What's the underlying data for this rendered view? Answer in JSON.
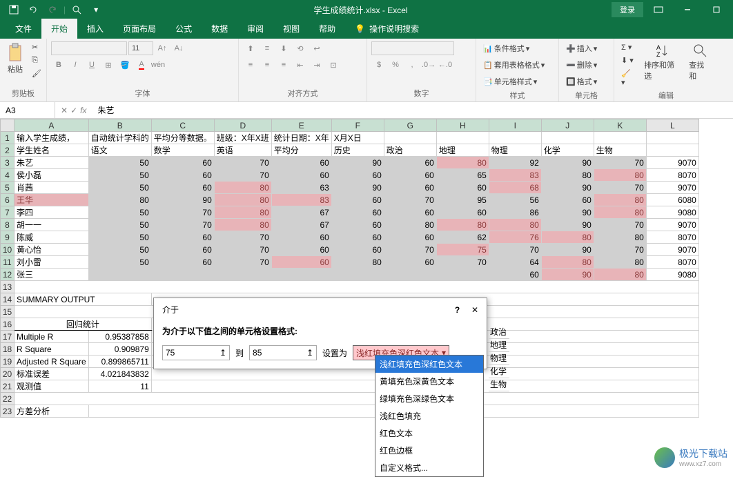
{
  "app": {
    "title": "学生成绩统计.xlsx - Excel",
    "login": "登录"
  },
  "tabs": [
    "文件",
    "开始",
    "插入",
    "页面布局",
    "公式",
    "数据",
    "审阅",
    "视图",
    "帮助"
  ],
  "tellme": "操作说明搜索",
  "ribbon": {
    "clipboard": {
      "paste": "粘贴",
      "label": "剪贴板"
    },
    "font": {
      "label": "字体"
    },
    "align": {
      "label": "对齐方式"
    },
    "number": {
      "label": "数字"
    },
    "styles": {
      "cond": "条件格式",
      "table": "套用表格格式",
      "cell": "单元格样式",
      "label": "样式"
    },
    "cells": {
      "insert": "插入",
      "delete": "删除",
      "format": "格式",
      "label": "单元格"
    },
    "editing": {
      "sort": "排序和筛选",
      "find": "查找和",
      "label": "编辑"
    }
  },
  "formula": {
    "name": "A3",
    "fx": "fx",
    "value": "朱艺"
  },
  "columns": [
    "",
    "A",
    "B",
    "C",
    "D",
    "E",
    "F",
    "G",
    "H",
    "I",
    "J",
    "K",
    "L"
  ],
  "rows": [
    {
      "n": "1",
      "cells": [
        "输入学生成绩，",
        "自动统计学科的",
        "平均分等数据。",
        "班级：X年X班",
        "统计日期：X年",
        "X月X日",
        "",
        "",
        "",
        "",
        "",
        ""
      ]
    },
    {
      "n": "2",
      "cells": [
        "学生姓名",
        "语文",
        "数学",
        "英语",
        "平均分",
        "历史",
        "政治",
        "地理",
        "物理",
        "化学",
        "生物",
        ""
      ]
    },
    {
      "n": "3",
      "cells": [
        "朱艺",
        "50",
        "60",
        "70",
        "60",
        "90",
        "60",
        "80",
        "92",
        "90",
        "70",
        "9070"
      ]
    },
    {
      "n": "4",
      "cells": [
        "侯小磊",
        "50",
        "60",
        "70",
        "60",
        "60",
        "60",
        "65",
        "83",
        "80",
        "80",
        "8070"
      ]
    },
    {
      "n": "5",
      "cells": [
        "肖茜",
        "50",
        "60",
        "80",
        "63",
        "90",
        "60",
        "60",
        "68",
        "90",
        "70",
        "9070"
      ]
    },
    {
      "n": "6",
      "cells": [
        "王华",
        "80",
        "90",
        "80",
        "83",
        "60",
        "70",
        "95",
        "56",
        "60",
        "80",
        "6080"
      ]
    },
    {
      "n": "7",
      "cells": [
        "李四",
        "50",
        "70",
        "80",
        "67",
        "60",
        "60",
        "60",
        "86",
        "90",
        "80",
        "9080"
      ]
    },
    {
      "n": "8",
      "cells": [
        "胡一一",
        "50",
        "70",
        "80",
        "67",
        "60",
        "80",
        "80",
        "80",
        "90",
        "70",
        "9070"
      ]
    },
    {
      "n": "9",
      "cells": [
        "陈威",
        "50",
        "60",
        "70",
        "60",
        "60",
        "60",
        "62",
        "76",
        "80",
        "80",
        "8070"
      ]
    },
    {
      "n": "10",
      "cells": [
        "黄心怡",
        "50",
        "60",
        "70",
        "60",
        "60",
        "70",
        "75",
        "70",
        "90",
        "70",
        "9070"
      ]
    },
    {
      "n": "11",
      "cells": [
        "刘小雷",
        "50",
        "60",
        "70",
        "60",
        "80",
        "60",
        "70",
        "64",
        "80",
        "80",
        "8070"
      ]
    },
    {
      "n": "12",
      "cells": [
        "张三",
        "",
        "",
        "",
        "",
        "",
        "",
        "",
        "60",
        "90",
        "80",
        "9080"
      ]
    }
  ],
  "summary": {
    "title": "SUMMARY OUTPUT",
    "section": "回归统计",
    "items": [
      {
        "k": "Multiple R",
        "v": "0.95387858"
      },
      {
        "k": "R Square",
        "v": "0.909879"
      },
      {
        "k": "Adjusted R Square",
        "v": "0.899865711"
      },
      {
        "k": "标准误差",
        "v": "4.021843832"
      },
      {
        "k": "观测值",
        "v": "11"
      }
    ],
    "anova": "方差分析"
  },
  "dialog": {
    "title": "介于",
    "help": "?",
    "label": "为介于以下值之间的单元格设置格式:",
    "from": "75",
    "to_label": "到",
    "to": "85",
    "set_as": "设置为",
    "selected": "浅红填充色深红色文本",
    "options": [
      "浅红填充色深红色文本",
      "黄填充色深黄色文本",
      "绿填充色深绿色文本",
      "浅红色填充",
      "红色文本",
      "红色边框",
      "自定义格式..."
    ]
  },
  "side_labels": [
    "政治",
    "地理",
    "物理",
    "化学",
    "生物"
  ],
  "watermark": {
    "name": "极光下载站",
    "url": "www.xz7.com"
  }
}
